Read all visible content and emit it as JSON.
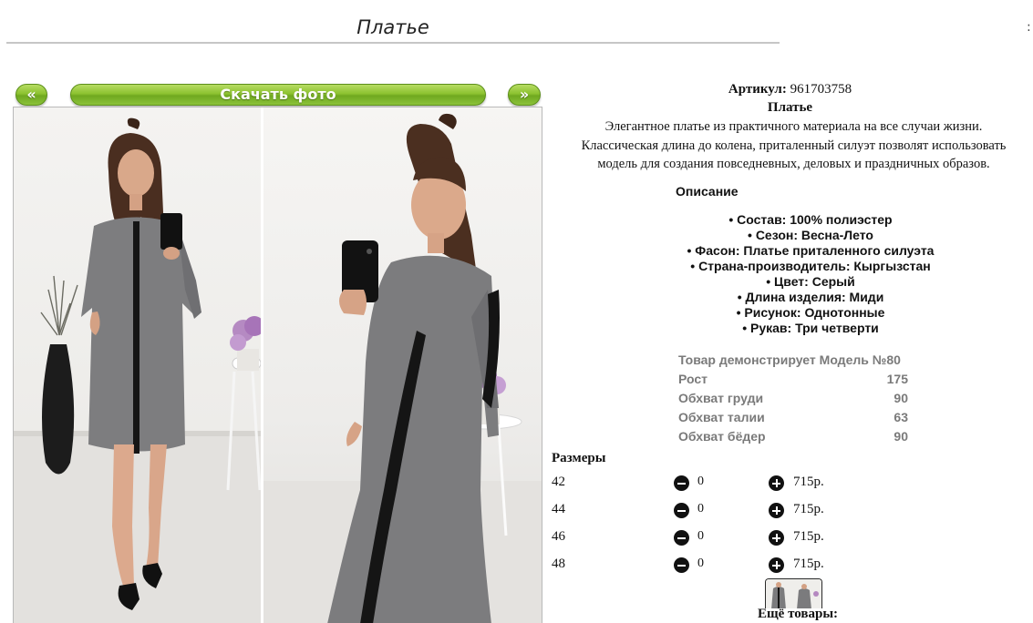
{
  "page": {
    "title": "Платье",
    "edge_mark": ":"
  },
  "gallery": {
    "prev_label": "«",
    "download_label": "Скачать фото",
    "next_label": "»"
  },
  "product": {
    "article_label": "Артикул:",
    "article_value": "961703758",
    "name": "Платье",
    "description_lines": [
      "Элегантное платье из практичного материала на все случаи жизни.",
      "Классическая длина до колена, приталенный силуэт позволят использовать",
      "модель для создания повседневных, деловых и праздничных образов."
    ]
  },
  "details": {
    "heading": "Описание",
    "features": [
      "• Состав: 100% полиэстер",
      "• Сезон: Весна-Лето",
      "• Фасон: Платье приталенного силуэта",
      "• Страна-производитель: Кыргызстан",
      "• Цвет: Серый",
      "• Длина изделия: Миди",
      "• Рисунок: Однотонные",
      "• Рукав: Три четверти"
    ]
  },
  "model": {
    "title": "Товар демонстрирует Модель №80",
    "rows": [
      {
        "label": "Рост",
        "value": "175"
      },
      {
        "label": "Обхват груди",
        "value": "90"
      },
      {
        "label": "Обхват талии",
        "value": "63"
      },
      {
        "label": "Обхват бёдер",
        "value": "90"
      }
    ]
  },
  "sizes": {
    "heading": "Размеры",
    "rows": [
      {
        "size": "42",
        "qty": "0",
        "price": "715р."
      },
      {
        "size": "44",
        "qty": "0",
        "price": "715р."
      },
      {
        "size": "46",
        "qty": "0",
        "price": "715р."
      },
      {
        "size": "48",
        "qty": "0",
        "price": "715р."
      }
    ]
  },
  "more": {
    "label": "Ещё товары:"
  },
  "colors": {
    "button_green": "#8cc230",
    "dress_grey": "#7a7a7c",
    "model_text": "#7a7a7a"
  },
  "icons": {
    "minus": "minus-circle-icon",
    "plus": "plus-circle-icon"
  }
}
